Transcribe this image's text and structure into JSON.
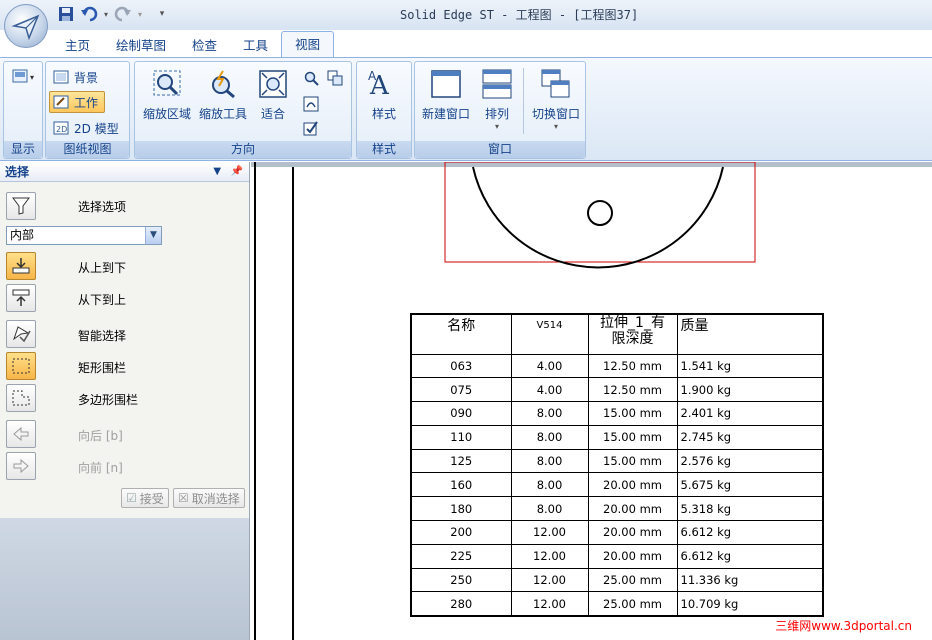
{
  "window": {
    "title": "Solid Edge ST - 工程图 - [工程图37]"
  },
  "tabs": [
    {
      "label": "主页"
    },
    {
      "label": "绘制草图"
    },
    {
      "label": "检查"
    },
    {
      "label": "工具"
    },
    {
      "label": "视图",
      "active": true
    }
  ],
  "ribbon": {
    "groups": {
      "display": {
        "label": "显示"
      },
      "sheet_view": {
        "label": "图纸视图",
        "items": [
          {
            "label": "背景"
          },
          {
            "label": "工作",
            "selected": true
          },
          {
            "label": "2D 模型"
          }
        ]
      },
      "orient": {
        "label": "方向",
        "buttons": [
          {
            "label": "缩放区域"
          },
          {
            "label": "缩放工具"
          },
          {
            "label": "适合"
          }
        ]
      },
      "style": {
        "label": "样式",
        "buttons": [
          {
            "label": "样式"
          }
        ]
      },
      "window": {
        "label": "窗口",
        "buttons": [
          {
            "label": "新建窗口"
          },
          {
            "label": "排列"
          },
          {
            "label": "切换窗口"
          }
        ]
      }
    }
  },
  "panel": {
    "title": "选择",
    "select_options": "选择选项",
    "filter_value": "内部",
    "items": [
      {
        "label": "从上到下",
        "active": true
      },
      {
        "label": "从下到上"
      },
      {
        "label": "智能选择"
      },
      {
        "label": "矩形围栏",
        "active": true
      },
      {
        "label": "多边形围栏"
      },
      {
        "label": "向后 [b]",
        "disabled": true
      },
      {
        "label": "向前 [n]",
        "disabled": true
      }
    ],
    "accept_label": "接受",
    "cancel_label": "取消选择"
  },
  "bom": {
    "headers": [
      "名称",
      "V514",
      "拉伸_1_有\n限深度",
      "质量"
    ],
    "rows": [
      [
        "063",
        "4.00",
        "12.50 mm",
        "1.541 kg"
      ],
      [
        "075",
        "4.00",
        "12.50 mm",
        "1.900 kg"
      ],
      [
        "090",
        "8.00",
        "15.00 mm",
        "2.401 kg"
      ],
      [
        "110",
        "8.00",
        "15.00 mm",
        "2.745 kg"
      ],
      [
        "125",
        "8.00",
        "15.00 mm",
        "2.576 kg"
      ],
      [
        "160",
        "8.00",
        "20.00 mm",
        "5.675 kg"
      ],
      [
        "180",
        "8.00",
        "20.00 mm",
        "5.318 kg"
      ],
      [
        "200",
        "12.00",
        "20.00 mm",
        "6.612 kg"
      ],
      [
        "225",
        "12.00",
        "20.00 mm",
        "6.612 kg"
      ],
      [
        "250",
        "12.00",
        "25.00 mm",
        "11.336 kg"
      ],
      [
        "280",
        "12.00",
        "25.00 mm",
        "10.709 kg"
      ]
    ]
  },
  "watermark": "三维网www.3dportal.cn",
  "colors": {
    "ribbon_text": "#15428b",
    "drawing_frame": "#cc0000",
    "accent_selected": "#ffc75c"
  }
}
